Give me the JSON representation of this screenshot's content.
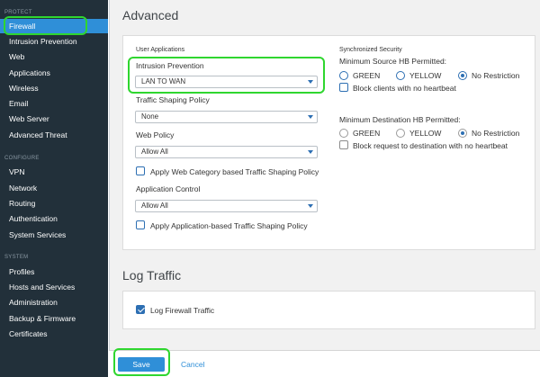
{
  "sidebar": {
    "sections": [
      "PROTECT",
      "CONFIGURE",
      "SYSTEM"
    ],
    "protect_items": [
      "Firewall",
      "Intrusion Prevention",
      "Web",
      "Applications",
      "Wireless",
      "Email",
      "Web Server",
      "Advanced Threat"
    ],
    "configure_items": [
      "VPN",
      "Network",
      "Routing",
      "Authentication",
      "System Services"
    ],
    "system_items": [
      "Profiles",
      "Hosts and Services",
      "Administration",
      "Backup & Firmware",
      "Certificates"
    ],
    "active": "Firewall"
  },
  "advanced": {
    "title": "Advanced",
    "user_apps": {
      "heading": "User Applications",
      "ips_label": "Intrusion Prevention",
      "ips_value": "LAN TO WAN",
      "tsp_label": "Traffic Shaping Policy",
      "tsp_value": "None",
      "web_label": "Web Policy",
      "web_value": "Allow All",
      "web_cat_cb": "Apply Web Category based Traffic Shaping Policy",
      "app_label": "Application Control",
      "app_value": "Allow All",
      "app_cb": "Apply Application-based Traffic Shaping Policy"
    },
    "sync_sec": {
      "heading": "Synchronized Security",
      "min_source_label": "Minimum Source HB Permitted:",
      "min_dest_label": "Minimum Destination HB Permitted:",
      "opt_green": "GREEN",
      "opt_yellow": "YELLOW",
      "opt_none": "No Restriction",
      "block_clients": "Block clients with no heartbeat",
      "block_request": "Block request to destination with no heartbeat"
    }
  },
  "log": {
    "title": "Log Traffic",
    "cb_label": "Log Firewall Traffic"
  },
  "footer": {
    "save": "Save",
    "cancel": "Cancel"
  },
  "colors": {
    "sidebar_bg": "#22303a",
    "accent": "#2f8fd8",
    "highlight": "#2fd62f"
  }
}
